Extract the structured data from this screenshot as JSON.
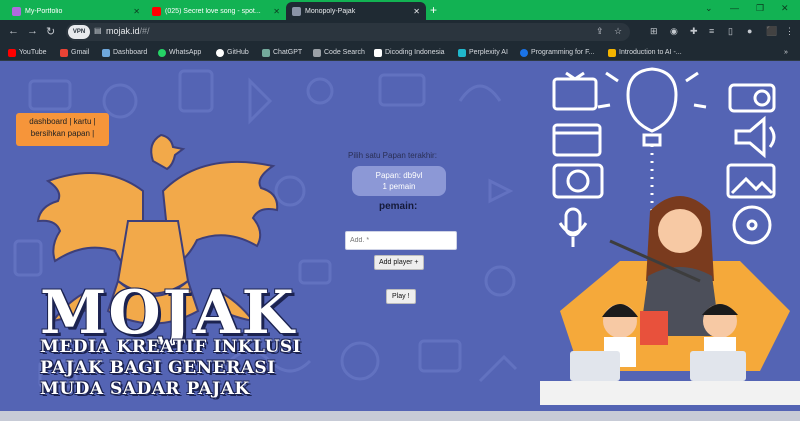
{
  "browser": {
    "tabs": [
      {
        "title": "My-Portfolio",
        "active": false,
        "favicon_color": "#b06adf"
      },
      {
        "title": "(025) Secret love song - spot...",
        "active": false,
        "favicon_color": "#ff0000"
      },
      {
        "title": "Monopoly-Pajak",
        "active": true,
        "favicon_color": "#8a93a6"
      }
    ],
    "new_tab": "+",
    "address": {
      "host": "mojak.id",
      "path": "/#/",
      "site_badge": "VPN"
    },
    "bookmarks": [
      {
        "label": "YouTube",
        "color": "#ff0000"
      },
      {
        "label": "Gmail",
        "color": "#ea4335"
      },
      {
        "label": "Dashboard",
        "color": "#6fa8dc"
      },
      {
        "label": "WhatsApp",
        "color": "#25d366"
      },
      {
        "label": "GitHub",
        "color": "#ffffff"
      },
      {
        "label": "ChatGPT",
        "color": "#74aa9c"
      },
      {
        "label": "Code Search",
        "color": "#9aa0a6"
      },
      {
        "label": "Dicoding Indonesia",
        "color": "#ffffff"
      },
      {
        "label": "Perplexity AI",
        "color": "#20b8cd"
      },
      {
        "label": "Programming for F...",
        "color": "#1a73e8"
      },
      {
        "label": "Introduction to AI -...",
        "color": "#f4b400"
      }
    ]
  },
  "page": {
    "nav": {
      "dashboard": "dashboard",
      "kartu": "kartu",
      "bersihkan": "bersihkan papan",
      "sep": "|"
    },
    "hero": {
      "title": "MOJAK",
      "lines": [
        "MEDIA KREATIF INKLUSI",
        "PAJAK BAGI GENERASI",
        "MUDA SADAR PAJAK"
      ]
    },
    "game": {
      "pick_board_label": "Pilih satu Papan terakhir:",
      "board_name": "Papan: db9vl",
      "board_players": "1 pemain",
      "players_label": "pemain:",
      "player_input_placeholder": "Add. *",
      "add_player_button": "Add player +",
      "play_button": "Play !"
    }
  },
  "colors": {
    "tab_strip": "#12b253",
    "page_background": "#5464b4",
    "nav_background": "#f6953a",
    "garuda": "#f2a94a",
    "board_card": "#8c98d6"
  }
}
